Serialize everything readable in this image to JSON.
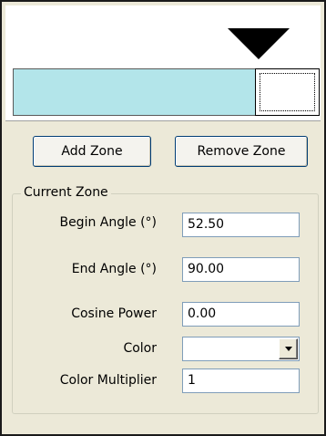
{
  "buttons": {
    "add_zone": "Add Zone",
    "remove_zone": "Remove Zone"
  },
  "current_zone": {
    "title": "Current Zone",
    "begin_angle": {
      "label": "Begin Angle (°)",
      "value": "52.50"
    },
    "end_angle": {
      "label": "End Angle (°)",
      "value": "90.00"
    },
    "cosine_power": {
      "label": "Cosine Power",
      "value": "0.00"
    },
    "color": {
      "label": "Color",
      "value": ""
    },
    "color_multiplier": {
      "label": "Color Multiplier",
      "value": "1"
    }
  },
  "zone_strip": {
    "zone_color": "#b3e5ea",
    "selected_zone_color": "#ffffff"
  }
}
